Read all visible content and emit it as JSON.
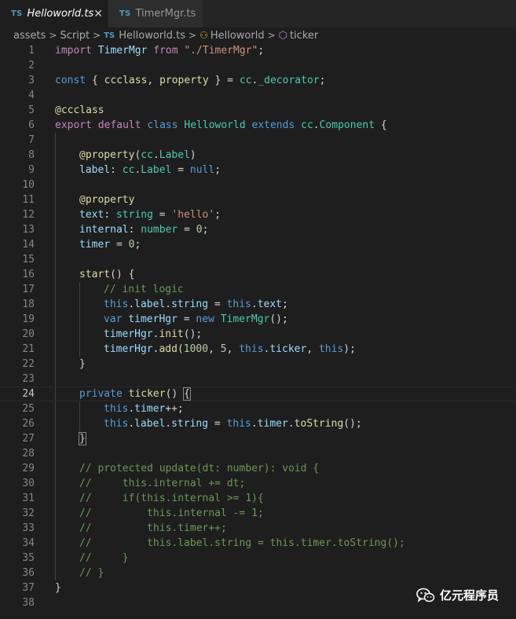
{
  "tabs": [
    {
      "badge": "TS",
      "label": "Helloworld.ts",
      "close": "✕"
    },
    {
      "badge": "TS",
      "label": "TimerMgr.ts"
    }
  ],
  "breadcrumb": {
    "folder1": "assets",
    "folder2": "Script",
    "file_badge": "TS",
    "file": "Helloworld.ts",
    "class": "Helloworld",
    "method": "ticker",
    "separator": ">"
  },
  "line_numbers": [
    "1",
    "2",
    "3",
    "4",
    "5",
    "6",
    "7",
    "8",
    "9",
    "10",
    "11",
    "12",
    "13",
    "14",
    "15",
    "16",
    "17",
    "18",
    "19",
    "20",
    "21",
    "22",
    "23",
    "24",
    "25",
    "26",
    "27",
    "28",
    "29",
    "30",
    "31",
    "32",
    "33",
    "34",
    "35",
    "36",
    "37",
    "38"
  ],
  "code": {
    "l1": [
      "import",
      " ",
      "TimerMgr",
      " ",
      "from",
      " ",
      "\"./TimerMgr\"",
      ";"
    ],
    "l3": [
      "const",
      " { ",
      "ccclass",
      ", ",
      "property",
      " } = ",
      "cc",
      ".",
      "_decorator",
      ";"
    ],
    "l5": [
      "@ccclass"
    ],
    "l6": [
      "export",
      " ",
      "default",
      " ",
      "class",
      " ",
      "Helloworld",
      " ",
      "extends",
      " ",
      "cc",
      ".",
      "Component",
      " {"
    ],
    "l8": [
      "@property",
      "(",
      "cc",
      ".",
      "Label",
      ")"
    ],
    "l9": [
      "label",
      ": ",
      "cc",
      ".",
      "Label",
      " = ",
      "null",
      ";"
    ],
    "l11": [
      "@property"
    ],
    "l12": [
      "text",
      ": ",
      "string",
      " = ",
      "'hello'",
      ";"
    ],
    "l13": [
      "internal",
      ": ",
      "number",
      " = ",
      "0",
      ";"
    ],
    "l14": [
      "timer",
      " = ",
      "0",
      ";"
    ],
    "l16": [
      "start",
      "() {"
    ],
    "l17": [
      "// init logic"
    ],
    "l18": [
      "this",
      ".",
      "label",
      ".",
      "string",
      " = ",
      "this",
      ".",
      "text",
      ";"
    ],
    "l19": [
      "var",
      " ",
      "timerHgr",
      " = ",
      "new",
      " ",
      "TimerMgr",
      "();"
    ],
    "l20": [
      "timerHgr",
      ".",
      "init",
      "();"
    ],
    "l21": [
      "timerHgr",
      ".",
      "add",
      "(",
      "1000",
      ", ",
      "5",
      ", ",
      "this",
      ".",
      "ticker",
      ", ",
      "this",
      ");"
    ],
    "l22": [
      "}"
    ],
    "l24": [
      "private",
      " ",
      "ticker",
      "() ",
      "{"
    ],
    "l25": [
      "this",
      ".",
      "timer",
      "++;"
    ],
    "l26": [
      "this",
      ".",
      "label",
      ".",
      "string",
      " = ",
      "this",
      ".",
      "timer",
      ".",
      "toString",
      "();"
    ],
    "l27": [
      "}"
    ],
    "l29": [
      "// protected update(dt: number): void {"
    ],
    "l30": [
      "//     this.internal += dt;"
    ],
    "l31": [
      "//     if(this.internal >= 1){"
    ],
    "l32": [
      "//         this.internal -= 1;"
    ],
    "l33": [
      "//         this.timer++;"
    ],
    "l34": [
      "//         this.label.string = this.timer.toString();"
    ],
    "l35": [
      "//     }"
    ],
    "l36": [
      "// }"
    ],
    "l37": [
      "}"
    ]
  },
  "watermark": {
    "text": "亿元程序员",
    "icon": "wechat-icon"
  },
  "colors": {
    "keyword": "#569cd6",
    "control": "#c586c0",
    "type": "#4ec9b0",
    "function": "#dcdcaa",
    "variable": "#9cdcfe",
    "string": "#ce9178",
    "number": "#b5cea8",
    "comment": "#6a9955"
  }
}
